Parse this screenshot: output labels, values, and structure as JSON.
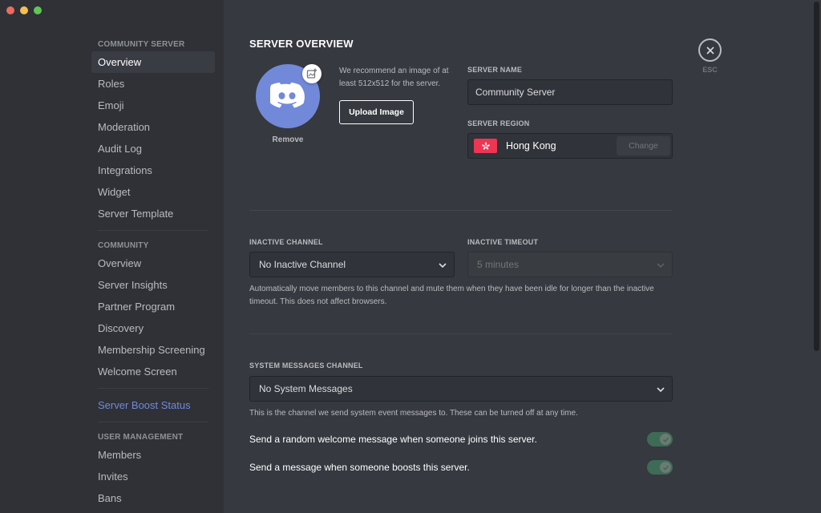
{
  "sidebar": {
    "sections": [
      {
        "header": "COMMUNITY SERVER",
        "items": [
          {
            "label": "Overview",
            "selected": true
          },
          {
            "label": "Roles"
          },
          {
            "label": "Emoji"
          },
          {
            "label": "Moderation"
          },
          {
            "label": "Audit Log"
          },
          {
            "label": "Integrations"
          },
          {
            "label": "Widget"
          },
          {
            "label": "Server Template"
          }
        ]
      },
      {
        "header": "COMMUNITY",
        "items": [
          {
            "label": "Overview"
          },
          {
            "label": "Server Insights"
          },
          {
            "label": "Partner Program"
          },
          {
            "label": "Discovery"
          },
          {
            "label": "Membership Screening"
          },
          {
            "label": "Welcome Screen"
          }
        ]
      },
      {
        "header": "",
        "items": [
          {
            "label": "Server Boost Status",
            "accent": true
          }
        ]
      },
      {
        "header": "USER MANAGEMENT",
        "items": [
          {
            "label": "Members"
          },
          {
            "label": "Invites"
          },
          {
            "label": "Bans"
          }
        ]
      }
    ]
  },
  "main": {
    "title": "SERVER OVERVIEW",
    "avatar": {
      "icon": "discord-logo-icon",
      "color": "#7289da",
      "remove_label": "Remove"
    },
    "recommend_text": "We recommend an image of at least 512x512 for the server.",
    "upload_label": "Upload Image",
    "server_name": {
      "label": "SERVER NAME",
      "value": "Community Server"
    },
    "server_region": {
      "label": "SERVER REGION",
      "value": "Hong Kong",
      "flag_icon": "hong-kong-flag-icon",
      "change_label": "Change"
    },
    "inactive_channel": {
      "label": "INACTIVE CHANNEL",
      "value": "No Inactive Channel"
    },
    "inactive_timeout": {
      "label": "INACTIVE TIMEOUT",
      "value": "5 minutes"
    },
    "inactive_help": "Automatically move members to this channel and mute them when they have been idle for longer than the inactive timeout. This does not affect browsers.",
    "system_messages": {
      "label": "SYSTEM MESSAGES CHANNEL",
      "value": "No System Messages"
    },
    "system_help": "This is the channel we send system event messages to. These can be turned off at any time.",
    "toggles": [
      {
        "label": "Send a random welcome message when someone joins this server.",
        "on": true
      },
      {
        "label": "Send a message when someone boosts this server.",
        "on": true
      }
    ]
  },
  "close": {
    "label": "ESC"
  },
  "colors": {
    "accent": "#7289da",
    "toggle_on": "#3e6b57",
    "flag": "#ee3553"
  }
}
